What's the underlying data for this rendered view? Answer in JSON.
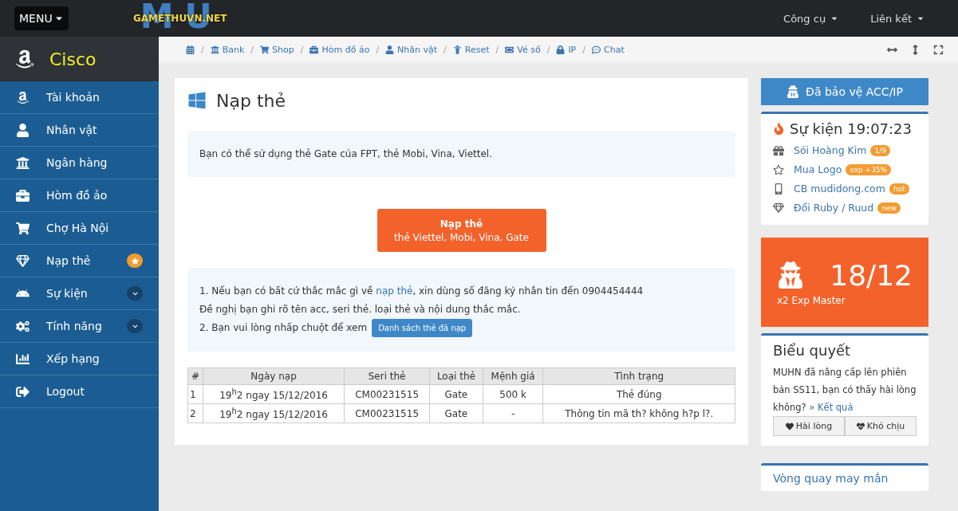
{
  "topbar": {
    "menu_label": "MENU",
    "logo_text": "GAMETHUVN.NET",
    "logo_backdrop": "MU",
    "menus": [
      "Công cụ",
      "Liên kết"
    ]
  },
  "sidebar": {
    "brand": "Cisco",
    "items": [
      {
        "label": "Tài khoản",
        "kind": "plain"
      },
      {
        "label": "Nhân vật",
        "kind": "plain"
      },
      {
        "label": "Ngân hàng",
        "kind": "plain"
      },
      {
        "label": "Hòm đồ ảo",
        "kind": "plain"
      },
      {
        "label": "Chợ Hà Nội",
        "kind": "plain"
      },
      {
        "label": "Nạp thẻ",
        "kind": "starred"
      },
      {
        "label": "Sự kiện",
        "kind": "submenu"
      },
      {
        "label": "Tính năng",
        "kind": "submenu"
      },
      {
        "label": "Xếp hạng",
        "kind": "plain"
      },
      {
        "label": "Logout",
        "kind": "plain"
      }
    ]
  },
  "breadcrumb": [
    {
      "separator": "/",
      "label": "Bank"
    },
    {
      "separator": "/",
      "label": "Shop"
    },
    {
      "separator": "/",
      "label": "Hòm đồ ảo"
    },
    {
      "separator": "/",
      "label": "Nhân vật"
    },
    {
      "separator": "/",
      "label": "Reset"
    },
    {
      "separator": "/",
      "label": "Vé số"
    },
    {
      "separator": "/",
      "label": "IP"
    },
    {
      "separator": "/",
      "label": "Chat"
    }
  ],
  "panel": {
    "title": "Nạp thẻ",
    "info": "Bạn có thể sử dụng thẻ Gate của FPT, thẻ Mobi, Vina, Viettel.",
    "cta": {
      "title": "Nạp thẻ",
      "subtitle": "thẻ Viettel, Mobi, Vina, Gate"
    },
    "notes": {
      "line1_before": "1. Nếu bạn có bất cứ thắc mắc gì về ",
      "line1_link": "nạp thẻ",
      "line1_after": ", xin dùng số đăng ký nhắn tin đến 0904454444",
      "line2": "Đề nghị bạn ghi rõ tên acc, seri thẻ. loại thẻ và nội dung thắc mắc.",
      "line3": "2. Bạn vui lòng nhấp chuột để xem",
      "button": "Danh sách thẻ đã nạp"
    },
    "table": {
      "columns": [
        "#",
        "Ngày nạp",
        "Seri thẻ",
        "Loại thẻ",
        "Mệnh giá",
        "Tình trạng"
      ],
      "rows": [
        [
          "1",
          "19$^{h}$2 ngay 15/12/2016",
          "CM00231515",
          "Gate",
          "500 k",
          "Thẻ đúng"
        ],
        [
          "2",
          "19$^{h}$2 ngay 15/12/2016",
          "CM00231515",
          "Gate",
          "-",
          "Thông tin mã th? không h?p l?."
        ]
      ]
    }
  },
  "right": {
    "protect_button": "Đã bảo vệ ACC/IP",
    "events": {
      "title": "Sự kiện 19:07:23",
      "items": [
        {
          "label": "Sói Hoàng Kim",
          "badge": "1/9"
        },
        {
          "label": "Mua Logo",
          "badge": "exp +35%"
        },
        {
          "label": "CB mudidong.com",
          "badge": "hot"
        },
        {
          "label": "Đổi Ruby / Ruud",
          "badge": "new"
        }
      ]
    },
    "promo": {
      "value": "18/12",
      "caption": "x2 Exp Master"
    },
    "poll": {
      "title": "Biểu quyết",
      "question": "MUHN đã nâng cấp lên phiên bản SS11, bạn có thấy hài lòng không?",
      "result_link": "» Kết quả",
      "buttons": [
        "Hài lòng",
        "Khó chịu"
      ]
    },
    "wheel": {
      "title": "Vòng quay may mắn"
    }
  }
}
